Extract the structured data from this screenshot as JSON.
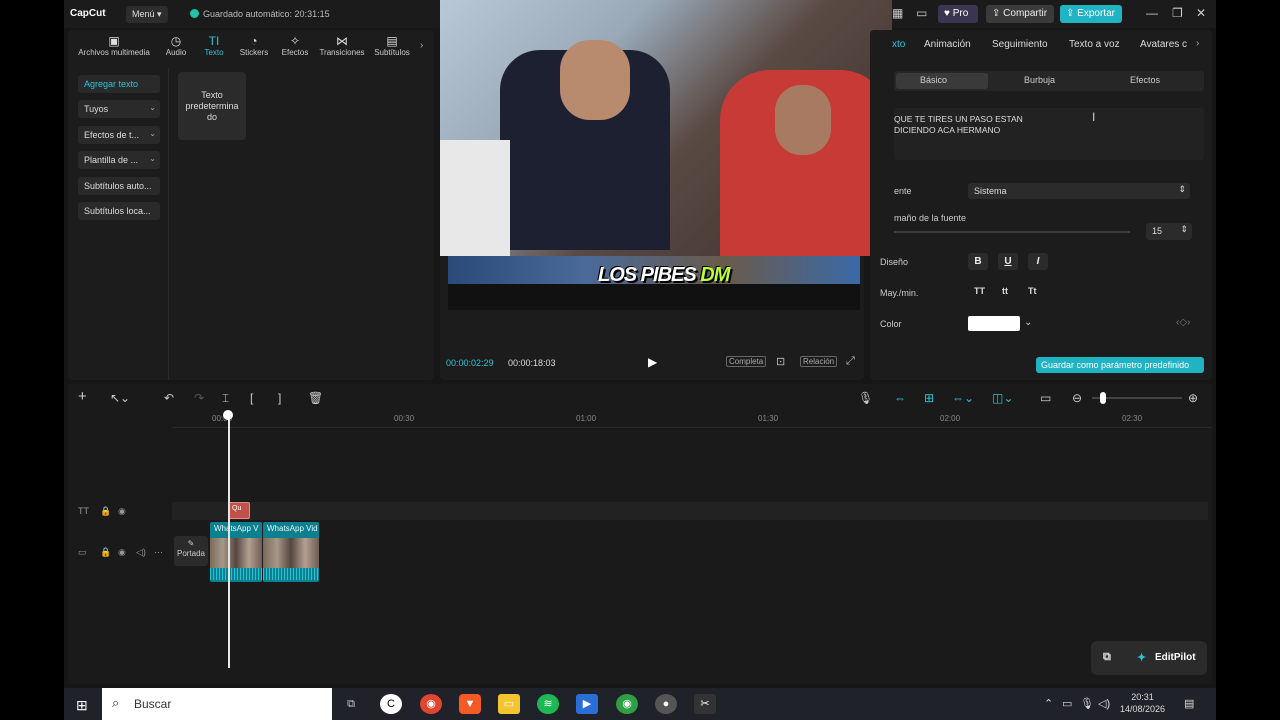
{
  "app": {
    "logo": "CapCut",
    "menu_label": "Menú",
    "autosave": "Guardado automático: 20:31:15",
    "pro_label": "Pro",
    "share_label": "Compartir",
    "export_label": "Exportar"
  },
  "left": {
    "tabs": [
      {
        "icon": "▣",
        "label": "Archivos multimedia"
      },
      {
        "icon": "◷",
        "label": "Audio"
      },
      {
        "icon": "TI",
        "label": "Texto"
      },
      {
        "icon": "◔",
        "label": "Stickers"
      },
      {
        "icon": "✧",
        "label": "Efectos"
      },
      {
        "icon": "⋈",
        "label": "Transiciones"
      },
      {
        "icon": "▤",
        "label": "Subtítulos"
      }
    ],
    "sidebar": [
      {
        "label": "Agregar texto"
      },
      {
        "label": "Tuyos"
      },
      {
        "label": "Efectos de t..."
      },
      {
        "label": "Plantilla de ..."
      },
      {
        "label": "Subtítulos auto..."
      },
      {
        "label": "Subtítulos loca..."
      }
    ],
    "tile_label": "Texto predetermina do"
  },
  "player": {
    "current_time": "00:00:02:29",
    "total_time": "00:00:18:03",
    "complete_label": "Completa",
    "ratio_label": "Relación",
    "banner_text": "LOS PIBES",
    "banner_accent": "DM"
  },
  "right": {
    "tabs": [
      "xto",
      "Animación",
      "Seguimiento",
      "Texto a voz",
      "Avatares c"
    ],
    "subtabs": [
      "Básico",
      "Burbuja",
      "Efectos"
    ],
    "text_content_line1": "QUE TE TIRES UN PASO ESTAN",
    "text_content_line2": "DICIENDO ACA HERMANO",
    "font_label": "ente",
    "font_value": "Sistema",
    "size_label": "maño de la fuente",
    "size_value": "15",
    "design_label": "Diseño",
    "bold": "B",
    "underline": "U",
    "italic": "I",
    "case_label": "May./min.",
    "case_options": [
      "TT",
      "tt",
      "Tt"
    ],
    "color_label": "Color",
    "color_value": "#ffffff",
    "preset_button": "Guardar como parámetro predefinido"
  },
  "timeline": {
    "ruler": [
      "00:00",
      "00:30",
      "01:00",
      "01:30",
      "02:00",
      "02:30"
    ],
    "text_clip": "Qu",
    "video_clips": [
      "WhatsApp V",
      "WhatsApp Vid"
    ],
    "cover_label": "Portada"
  },
  "editpilot": "EditPilot",
  "taskbar": {
    "search_placeholder": "Buscar",
    "time": "20:31",
    "date": "14/08/2026"
  }
}
